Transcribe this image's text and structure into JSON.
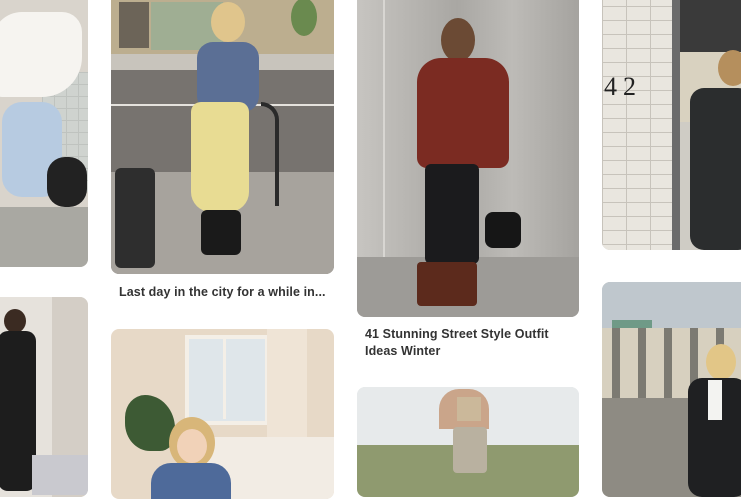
{
  "feed": {
    "pins": [
      {
        "id": "pin-1",
        "caption": ""
      },
      {
        "id": "pin-2",
        "caption": "Last day in the city for a while in..."
      },
      {
        "id": "pin-3",
        "caption": "41 Stunning Street Style Outfit Ideas Winter"
      },
      {
        "id": "pin-4",
        "caption": ""
      },
      {
        "id": "pin-5",
        "caption": ""
      },
      {
        "id": "pin-6",
        "caption": ""
      },
      {
        "id": "pin-7",
        "caption": ""
      },
      {
        "id": "pin-8",
        "caption": ""
      }
    ],
    "wall_number": "42"
  }
}
